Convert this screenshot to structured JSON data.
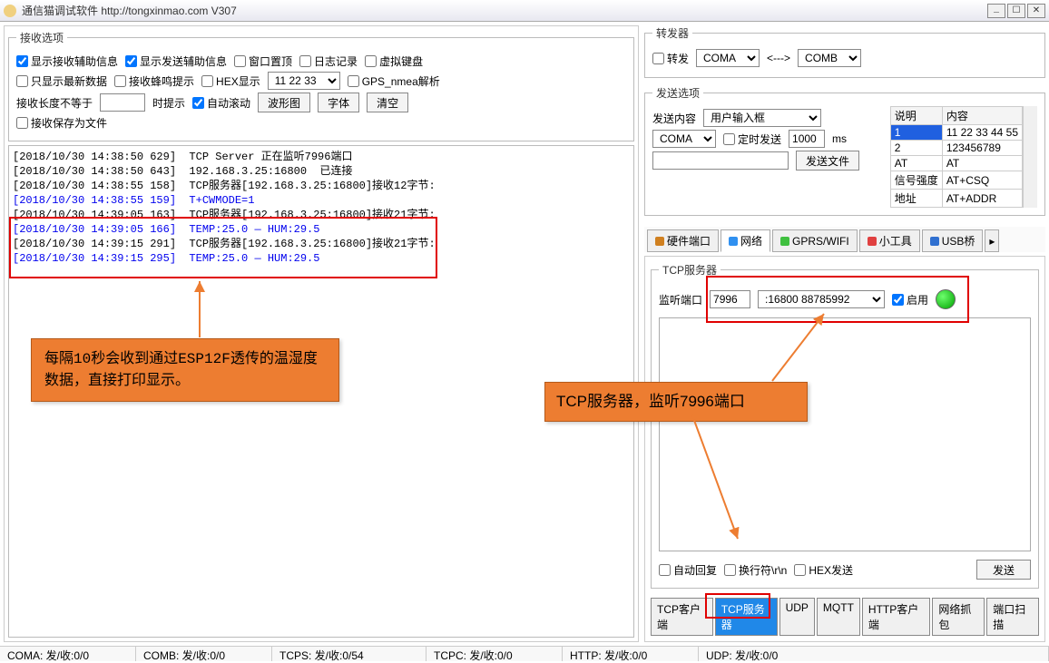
{
  "window": {
    "title": "通信猫调试软件  http://tongxinmao.com  V307"
  },
  "recv_options": {
    "legend": "接收选项",
    "cb_show_recv_aux": "显示接收辅助信息",
    "cb_show_send_aux": "显示发送辅助信息",
    "cb_on_top": "窗口置顶",
    "cb_log": "日志记录",
    "cb_virtual_kb": "虚拟键盘",
    "cb_latest_only": "只显示最新数据",
    "cb_beep": "接收蜂鸣提示",
    "cb_hex": "HEX显示",
    "hex_sample": "11 22 33",
    "cb_gps": "GPS_nmea解析",
    "len_neq_label": "接收长度不等于",
    "hint_label": "时提示",
    "cb_autoscroll": "自动滚动",
    "btn_wave": "波形图",
    "btn_font": "字体",
    "btn_clear": "清空",
    "cb_save_file": "接收保存为文件"
  },
  "log": [
    {
      "cls": "log-black",
      "text": "[2018/10/30 14:38:50 629]  TCP Server 正在监听7996端口"
    },
    {
      "cls": "log-black",
      "text": "[2018/10/30 14:38:50 643]  192.168.3.25:16800  已连接"
    },
    {
      "cls": "log-black",
      "text": "[2018/10/30 14:38:55 158]  TCP服务器[192.168.3.25:16800]接收12字节:"
    },
    {
      "cls": "log-blue",
      "text": "[2018/10/30 14:38:55 159]  T+CWMODE=1"
    },
    {
      "cls": "log-black",
      "text": ""
    },
    {
      "cls": "log-black",
      "text": "[2018/10/30 14:39:05 163]  TCP服务器[192.168.3.25:16800]接收21字节:"
    },
    {
      "cls": "log-blue",
      "text": "[2018/10/30 14:39:05 166]  TEMP:25.0 — HUM:29.5"
    },
    {
      "cls": "log-black",
      "text": "[2018/10/30 14:39:15 291]  TCP服务器[192.168.3.25:16800]接收21字节:"
    },
    {
      "cls": "log-blue",
      "text": "[2018/10/30 14:39:15 295]  TEMP:25.0 — HUM:29.5"
    }
  ],
  "callouts": {
    "left": "每隔10秒会收到通过ESP12F透传的温湿度数据，直接打印显示。",
    "right": "TCP服务器，监听7996端口"
  },
  "forwarder": {
    "legend": "转发器",
    "cb_forward": "转发",
    "from": "COMA",
    "arrow": "<--->",
    "to": "COMB"
  },
  "send_options": {
    "legend": "发送选项",
    "send_content_label": "发送内容",
    "send_content_value": "用户输入框",
    "port": "COMA",
    "cb_timed": "定时发送",
    "interval": "1000",
    "unit": "ms",
    "btn_send_file": "发送文件",
    "table": {
      "h1": "说明",
      "h2": "内容",
      "rows": [
        {
          "k": "1",
          "v": "11 22 33 44 55"
        },
        {
          "k": "2",
          "v": "123456789"
        },
        {
          "k": "AT",
          "v": "AT"
        },
        {
          "k": "信号强度",
          "v": "AT+CSQ"
        },
        {
          "k": "地址",
          "v": "AT+ADDR"
        }
      ]
    }
  },
  "tabs": {
    "hardware": "硬件端口",
    "network": "网络",
    "gprs": "GPRS/WIFI",
    "tools": "小工具",
    "usb": "USB桥"
  },
  "tcp_server": {
    "legend": "TCP服务器",
    "listen_port_label": "监听端口",
    "port": "7996",
    "conn": ":16800 88785992",
    "cb_enable": "启用",
    "cb_autoreply": "自动回复",
    "cb_crlf": "换行符\\r\\n",
    "cb_hex_send": "HEX发送",
    "btn_send": "发送"
  },
  "bottom_tabs": {
    "tcp_client": "TCP客户端",
    "tcp_server": "TCP服务器",
    "udp": "UDP",
    "mqtt": "MQTT",
    "http_client": "HTTP客户端",
    "packet": "网络抓包",
    "port_scan": "端口扫描"
  },
  "status": {
    "coma": "COMA: 发/收:0/0",
    "comb": "COMB: 发/收:0/0",
    "tcps": "TCPS: 发/收:0/54",
    "tcpc": "TCPC: 发/收:0/0",
    "http": "HTTP: 发/收:0/0",
    "udp": "UDP: 发/收:0/0"
  }
}
